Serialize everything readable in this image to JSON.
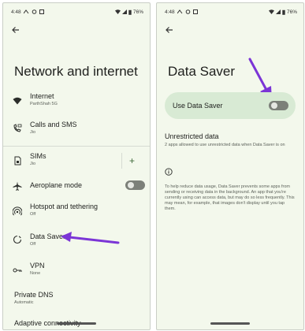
{
  "left_screen": {
    "status": {
      "time": "4:48",
      "battery": "76%"
    },
    "title": "Network and internet",
    "items": [
      {
        "label": "Internet",
        "sub": "ParthShah 5G"
      },
      {
        "label": "Calls and SMS",
        "sub": "Jio"
      },
      {
        "label": "SIMs",
        "sub": "Jio",
        "action": "+"
      },
      {
        "label": "Aeroplane mode",
        "sub": ""
      },
      {
        "label": "Hotspot and tethering",
        "sub": "Off"
      },
      {
        "label": "Data Saver",
        "sub": "Off"
      },
      {
        "label": "VPN",
        "sub": "None"
      },
      {
        "label": "Private DNS",
        "sub": "Automatic"
      },
      {
        "label": "Adaptive connectivity",
        "sub": ""
      }
    ]
  },
  "right_screen": {
    "status": {
      "time": "4:48",
      "battery": "76%"
    },
    "title": "Data Saver",
    "toggle_label": "Use Data Saver",
    "unrestricted_title": "Unrestricted data",
    "unrestricted_sub": "2 apps allowed to use unrestricted data when Data Saver is on",
    "info_text": "To help reduce data usage, Data Saver prevents some apps from sending or receiving data in the background. An app that you're currently using can access data, but may do so less frequently. This may mean, for example, that images don't display until you tap them."
  },
  "colors": {
    "accent": "#7b35d6",
    "card": "#d8ead4",
    "background": "#f3f8ec"
  }
}
